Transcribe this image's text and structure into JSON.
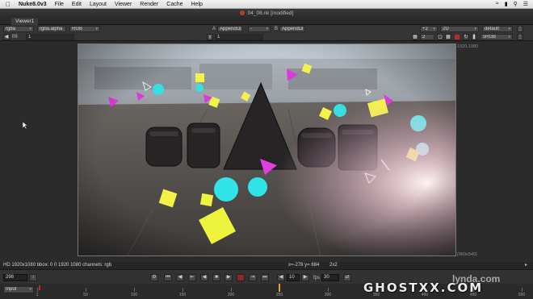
{
  "menubar": {
    "app_name": "Nuke8.0v3",
    "items": [
      "File",
      "Edit",
      "Layout",
      "Viewer",
      "Render",
      "Cache",
      "Help"
    ]
  },
  "window": {
    "title": "04_08.nk [modified]"
  },
  "tabs": {
    "viewer_tab": "Viewer1"
  },
  "toolbar1": {
    "channels": "rgba",
    "alpha": "rgba.alpha",
    "colorspace": "RGB",
    "a_label": "A",
    "a_input": "AppendCl",
    "wipe": "-",
    "b_label": "B",
    "b_input": "AppendCl",
    "zoom": "+2",
    "view_mode": "2D",
    "lut": "default"
  },
  "toolbar2": {
    "frame_ratio": "f/8",
    "frame_value": "1",
    "gamma_value": "1",
    "proxy": "2",
    "display": "sRGB"
  },
  "viewer": {
    "format_top": "1920,1080",
    "format_bottom": "(960x540)",
    "origin": "0,0",
    "scene_text": "SPACE"
  },
  "status": {
    "info": "HD 1920x1080  bbox: 0 0 1920 1080  channels: rgb",
    "coords": "x=-278  y= 684",
    "zoom": "2x2"
  },
  "transport": {
    "frame": "298",
    "step": "10",
    "fps_label": "fps",
    "fps_value": "30",
    "input_mode": "Input"
  },
  "timeline": {
    "ticks": [
      "1",
      "50",
      "100",
      "150",
      "200",
      "250",
      "300",
      "350",
      "400",
      "450",
      "500"
    ]
  },
  "watermark": {
    "text": "GHOSTXX.COM",
    "logo": "lynda.com"
  },
  "colors": {
    "accent": "#f0a030",
    "playhead": "#e8a23a",
    "record": "#c0282b"
  }
}
